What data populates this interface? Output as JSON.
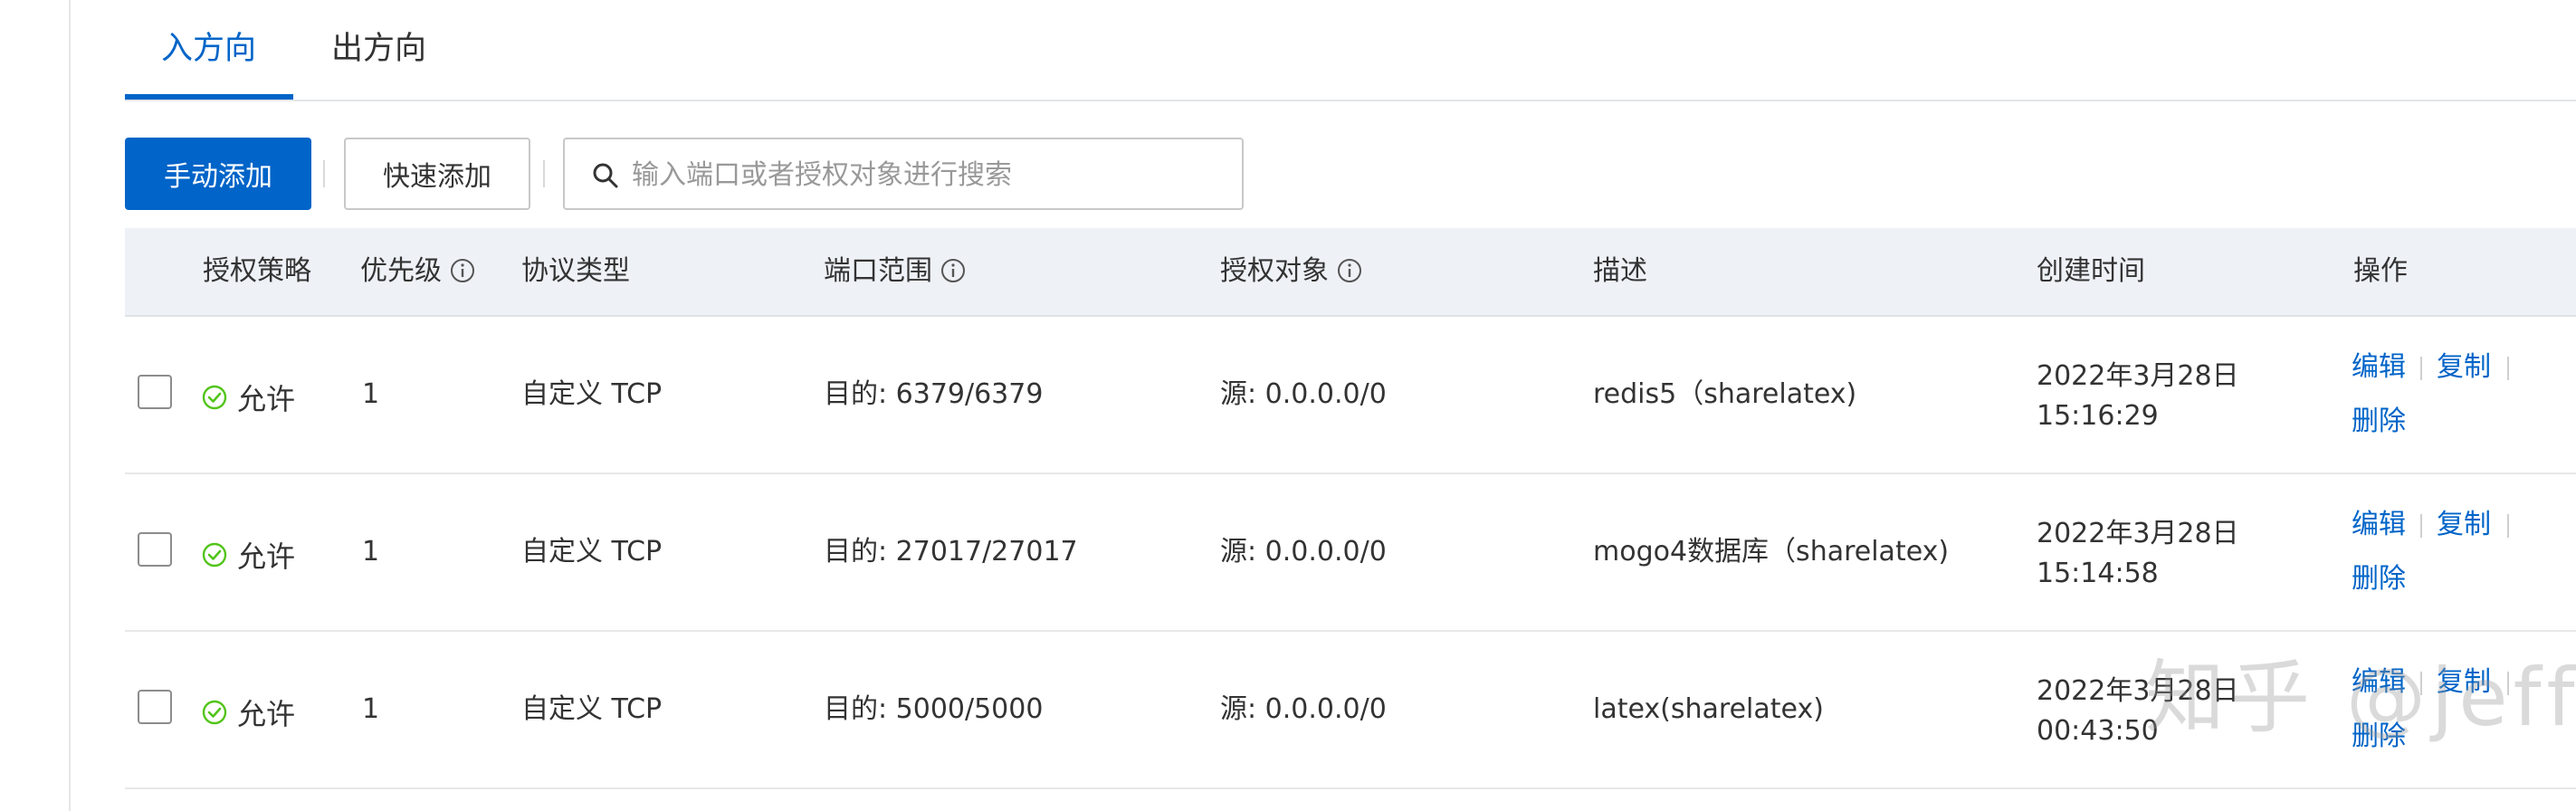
{
  "tabs": [
    {
      "label": "入方向",
      "active": true
    },
    {
      "label": "出方向",
      "active": false
    }
  ],
  "toolbar": {
    "manual_add_label": "手动添加",
    "quick_add_label": "快速添加",
    "search_placeholder": "输入端口或者授权对象进行搜索",
    "search_icon": "search-icon"
  },
  "table": {
    "columns": [
      "授权策略",
      "优先级",
      "协议类型",
      "端口范围",
      "授权对象",
      "描述",
      "创建时间",
      "操作"
    ],
    "info_icon_columns": [
      "优先级",
      "端口范围",
      "授权对象"
    ],
    "rows": [
      {
        "policy": "允许",
        "priority": "1",
        "protocol": "自定义 TCP",
        "port_range": "目的: 6379/6379",
        "source": "源: 0.0.0.0/0",
        "description": "redis5（sharelatex)",
        "created_date": "2022年3月28日",
        "created_time": "15:16:29",
        "actions": [
          "编辑",
          "复制",
          "删除"
        ]
      },
      {
        "policy": "允许",
        "priority": "1",
        "protocol": "自定义 TCP",
        "port_range": "目的: 27017/27017",
        "source": "源: 0.0.0.0/0",
        "description": "mogo4数据库（sharelatex)",
        "created_date": "2022年3月28日",
        "created_time": "15:14:58",
        "actions": [
          "编辑",
          "复制",
          "删除"
        ]
      },
      {
        "policy": "允许",
        "priority": "1",
        "protocol": "自定义 TCP",
        "port_range": "目的: 5000/5000",
        "source": "源: 0.0.0.0/0",
        "description": "latex(sharelatex)",
        "created_date": "2022年3月28日",
        "created_time": "00:43:50",
        "actions": [
          "编辑",
          "复制",
          "删除"
        ]
      }
    ]
  },
  "watermark": "知乎 @jeff",
  "colors": {
    "accent": "#0064c8",
    "allow_green": "#52c41a",
    "header_bg": "#eef1f6"
  }
}
